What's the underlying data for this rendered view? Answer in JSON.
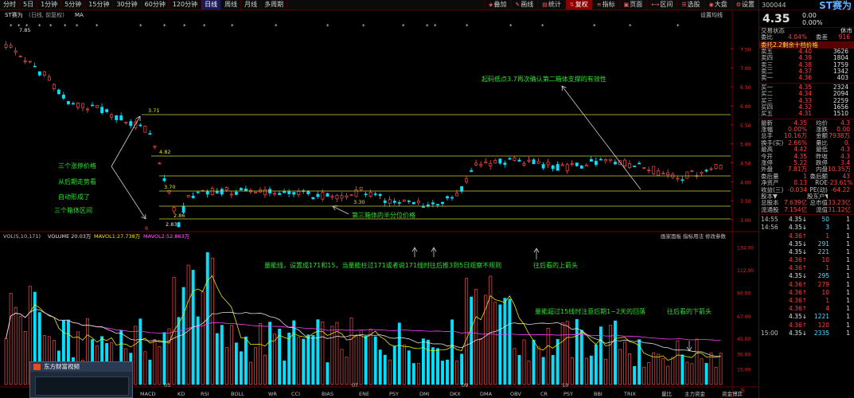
{
  "timeframes": [
    "分时",
    "5日",
    "1分钟",
    "5分钟",
    "15分钟",
    "30分钟",
    "60分钟",
    "120分钟",
    "日线",
    "周线",
    "月线",
    "多周期"
  ],
  "active_timeframe": "日线",
  "toolbar": [
    {
      "label": "叠加",
      "icon": "overlay-icon",
      "hl": false
    },
    {
      "label": "画线",
      "icon": "draw-icon",
      "hl": false
    },
    {
      "label": "统计",
      "icon": "stats-icon",
      "hl": false
    },
    {
      "label": "复权",
      "icon": "adjust-icon",
      "hl": true
    },
    {
      "label": "指标",
      "icon": "indicator-icon",
      "hl": false
    },
    {
      "label": "页面",
      "icon": "page-icon",
      "hl": false
    },
    {
      "label": "区间",
      "icon": "range-icon",
      "hl": false
    },
    {
      "label": "选股",
      "icon": "select-icon",
      "hl": false
    },
    {
      "label": "大盘",
      "icon": "market-icon",
      "hl": false
    },
    {
      "label": "设置",
      "icon": "settings-icon",
      "hl": false
    }
  ],
  "chart_header": {
    "name": "ST赛为",
    "mode": "(日线, 前复权)",
    "ma": "MA",
    "settings": "设置均线",
    "series_name_hdr": "ST赛为"
  },
  "vol_header": {
    "vol": "VOL(5,10,171)",
    "volume": "VOLUME 20.03万",
    "ma1": "MAVOL1:27.738万",
    "ma2": "MAVOL2:52.863万",
    "right1": "画家面板",
    "right2": "指标用法",
    "right3": "修改参数"
  },
  "bottom_indicators": [
    "MACD",
    "KD",
    "RSI",
    "BOLL",
    "WR",
    "CCI",
    "BIAS",
    "ENE",
    "PSY",
    "DMI",
    "DKX",
    "DMA",
    "OBV",
    "CR",
    "PSY",
    "BBI",
    "TRIX",
    "量比",
    "主力资金",
    "资金博弈",
    "更多"
  ],
  "date_labels": [
    "05",
    "07",
    "09",
    "10"
  ],
  "price_scale": [
    "7.50",
    "7.00",
    "6.50",
    "6.00",
    "5.50",
    "5.00",
    "4.50",
    "4.00",
    "3.50",
    "3.00"
  ],
  "vol_scale": [
    "134.00",
    "112.00",
    "90.00",
    "67.00",
    "45.00",
    "30.00",
    "15.00"
  ],
  "vol_unit": "万",
  "price_marks": {
    "high": "7.85",
    "low": "2.83",
    "l371": "3.71",
    "l482": "4.82",
    "l370": "3.70",
    "l286": "2.86",
    "l330": "3.30",
    "six": "6"
  },
  "annotations": {
    "a1": "三个涨停价格",
    "a2": "从后期走势看",
    "a3": "自动形成了",
    "a4": "三个箱体区间",
    "a5": "起码低点3.7再次确认第二箱体支撑的有效性",
    "a6": "第三箱体的半分位价格",
    "a7": "量能线，设置成171和15，当量能柱过171或者说171线时往后推3到5日观察不规则",
    "a8": "往后看的上箭头",
    "a9": "量能超过15线时注意后期1~2天的回落",
    "a10": "往后看的下箭头"
  },
  "popup_title": "东方财富视频",
  "side": {
    "code": "300044",
    "name": "ST赛为",
    "price": "4.35",
    "chg": "0.00",
    "pct": "0.00%",
    "status_l": "交易状态",
    "status_v": "休市",
    "ratio_l": "委比",
    "ratio_v": "4.04%",
    "diff_l": "委差",
    "diff_v": "916",
    "level_bar": "委托2.2剩余十档价格",
    "asks": [
      {
        "l": "卖五",
        "p": "4.40",
        "v": "3626"
      },
      {
        "l": "卖四",
        "p": "4.39",
        "v": "1804"
      },
      {
        "l": "卖三",
        "p": "4.38",
        "v": "1759"
      },
      {
        "l": "卖二",
        "p": "4.37",
        "v": "1342"
      },
      {
        "l": "卖一",
        "p": "4.36",
        "v": "403"
      }
    ],
    "bids": [
      {
        "l": "买一",
        "p": "4.35",
        "v": "2324"
      },
      {
        "l": "买二",
        "p": "4.34",
        "v": "2094"
      },
      {
        "l": "买三",
        "p": "4.33",
        "v": "2259"
      },
      {
        "l": "买四",
        "p": "4.32",
        "v": "1656"
      },
      {
        "l": "买五",
        "p": "4.31",
        "v": "1510"
      }
    ],
    "stats": [
      [
        "最新",
        "4.35",
        "均价",
        "4.3"
      ],
      [
        "涨幅",
        "0.00%",
        "涨跌",
        "0.00"
      ],
      [
        "总手",
        "10.16万",
        "金额",
        "7938万"
      ],
      [
        "换手(实)",
        "2.66%",
        "量比",
        "0."
      ],
      [
        "最高",
        "4.42",
        "最低",
        "4.3"
      ],
      [
        "今开",
        "4.35",
        "昨收",
        "4.3"
      ],
      [
        "涨停",
        "5.22",
        "跌停",
        "3.4"
      ],
      [
        "外盘",
        "7.81万",
        "内盘",
        "10.35万"
      ],
      [
        "委后量",
        "1",
        "委后额",
        "43"
      ],
      [
        "净资产",
        "0.13",
        "ROE",
        "-23.61%"
      ],
      [
        "收益(三)",
        "-0.034",
        "PE(动)",
        "-64.22"
      ],
      [
        "股本▼",
        "",
        "股东户▼",
        ""
      ],
      [
        "总股本",
        "7.639亿",
        "总市值",
        "33.23亿"
      ],
      [
        "流通股",
        "7.154亿",
        "流值",
        "31.12亿"
      ]
    ],
    "ticks": [
      {
        "t": "14:55",
        "p": "4.35",
        "a": "50",
        "c": "g"
      },
      {
        "t": "14:56",
        "p": "4.35",
        "a": "3",
        "c": "g"
      },
      {
        "t": "",
        "p": "4.36",
        "a": "1",
        "c": "r"
      },
      {
        "t": "",
        "p": "4.35",
        "a": "291",
        "c": "g"
      },
      {
        "t": "",
        "p": "4.35",
        "a": "221",
        "c": "g"
      },
      {
        "t": "",
        "p": "4.36",
        "a": "10",
        "c": "r"
      },
      {
        "t": "",
        "p": "4.36",
        "a": "1",
        "c": "r"
      },
      {
        "t": "",
        "p": "4.35",
        "a": "295",
        "c": "g"
      },
      {
        "t": "",
        "p": "4.36",
        "a": "279",
        "c": "r"
      },
      {
        "t": "",
        "p": "4.36",
        "a": "10",
        "c": "r"
      },
      {
        "t": "",
        "p": "4.36",
        "a": "1",
        "c": "r"
      },
      {
        "t": "",
        "p": "4.36",
        "a": "4",
        "c": "r"
      },
      {
        "t": "",
        "p": "4.35",
        "a": "1221",
        "c": "g"
      },
      {
        "t": "",
        "p": "4.36",
        "a": "120",
        "c": "r"
      },
      {
        "t": "15:00",
        "p": "4.35",
        "a": "2335",
        "c": "g"
      }
    ]
  }
}
